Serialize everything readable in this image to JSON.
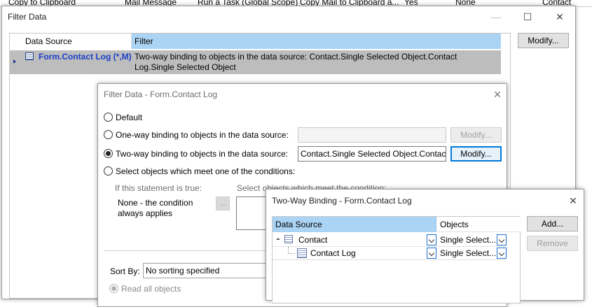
{
  "background_row": {
    "cells": [
      "Copy to Clipboard",
      "Mail Message",
      "Run a Task (Global Scope)",
      "Copy Mail to Clipboard a...",
      "Yes",
      "None",
      "Contact"
    ]
  },
  "filter_data": {
    "title": "Filter Data",
    "columns": {
      "data_source": "Data Source",
      "filter": "Filter"
    },
    "row": {
      "data_source": "Form.Contact Log (*,M)",
      "filter": "Two-way binding to objects in the data source: Contact.Single Selected Object.Contact Log.Single Selected Object"
    },
    "modify_button": "Modify..."
  },
  "filter_form": {
    "title": "Filter Data - Form.Contact Log",
    "options": {
      "default": "Default",
      "one_way": "One-way binding to objects in the data source:",
      "two_way": "Two-way binding to objects in the data source:",
      "select": "Select objects which meet one of the conditions:"
    },
    "selected_option": "two_way",
    "one_way_value": "",
    "two_way_value": "Contact.Single Selected Object.Contact",
    "one_way_modify": "Modify...",
    "two_way_modify": "Modify...",
    "if_statement_label": "If this statement is true:",
    "condition_line1": "None - the condition",
    "condition_line2": "always applies",
    "ellipsis_button": "...",
    "select_label": "Select objects which meet the condition:",
    "sort_by_label": "Sort By:",
    "sort_value": "No sorting specified",
    "read_all": "Read all objects"
  },
  "two_way": {
    "title": "Two-Way Binding - Form.Contact Log",
    "columns": {
      "data_source": "Data Source",
      "objects": "Objects"
    },
    "rows": [
      {
        "name": "Contact",
        "objects": "Single Select..."
      },
      {
        "name": "Contact Log",
        "objects": "Single Select..."
      }
    ],
    "add_button": "Add...",
    "remove_button": "Remove"
  }
}
